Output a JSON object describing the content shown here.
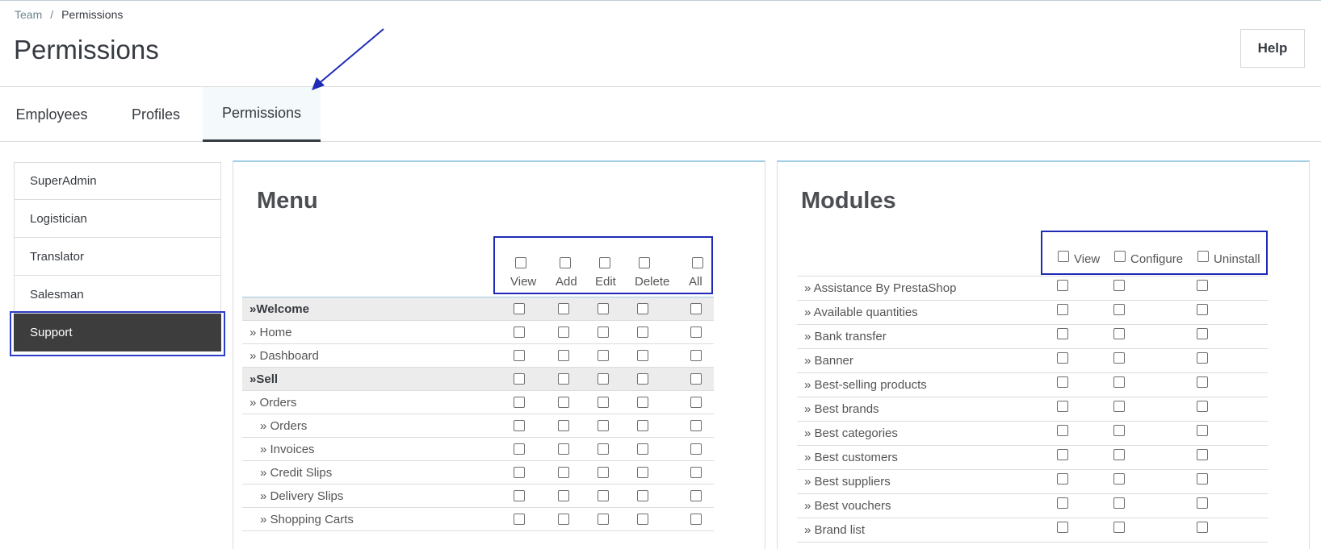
{
  "breadcrumb": {
    "parent": "Team",
    "separator": "/",
    "current": "Permissions"
  },
  "header": {
    "title": "Permissions",
    "help_label": "Help"
  },
  "tabs": [
    {
      "label": "Employees"
    },
    {
      "label": "Profiles"
    },
    {
      "label": "Permissions",
      "active": true
    }
  ],
  "profiles": [
    {
      "label": "SuperAdmin"
    },
    {
      "label": "Logistician"
    },
    {
      "label": "Translator"
    },
    {
      "label": "Salesman"
    },
    {
      "label": "Support",
      "active": true
    }
  ],
  "menu": {
    "title": "Menu",
    "columns": [
      "View",
      "Add",
      "Edit",
      "Delete",
      "All"
    ],
    "rows": [
      {
        "label": "»Welcome",
        "group": true
      },
      {
        "label": "» Home"
      },
      {
        "label": "» Dashboard"
      },
      {
        "label": "»Sell",
        "group": true
      },
      {
        "label": "» Orders"
      },
      {
        "label": "» Orders",
        "indent": true
      },
      {
        "label": "» Invoices",
        "indent": true
      },
      {
        "label": "» Credit Slips",
        "indent": true
      },
      {
        "label": "» Delivery Slips",
        "indent": true
      },
      {
        "label": "» Shopping Carts",
        "indent": true
      }
    ]
  },
  "modules": {
    "title": "Modules",
    "columns": [
      "View",
      "Configure",
      "Uninstall"
    ],
    "rows": [
      {
        "label": "» Assistance By PrestaShop"
      },
      {
        "label": "» Available quantities"
      },
      {
        "label": "» Bank transfer"
      },
      {
        "label": "» Banner"
      },
      {
        "label": "» Best-selling products"
      },
      {
        "label": "» Best brands"
      },
      {
        "label": "» Best categories"
      },
      {
        "label": "» Best customers"
      },
      {
        "label": "» Best suppliers"
      },
      {
        "label": "» Best vouchers"
      },
      {
        "label": "» Brand list"
      }
    ]
  },
  "colors": {
    "annotation": "#1f2bb7",
    "active_profile_bg": "#3d3d3d",
    "panel_top_border": "#9fcde4"
  }
}
